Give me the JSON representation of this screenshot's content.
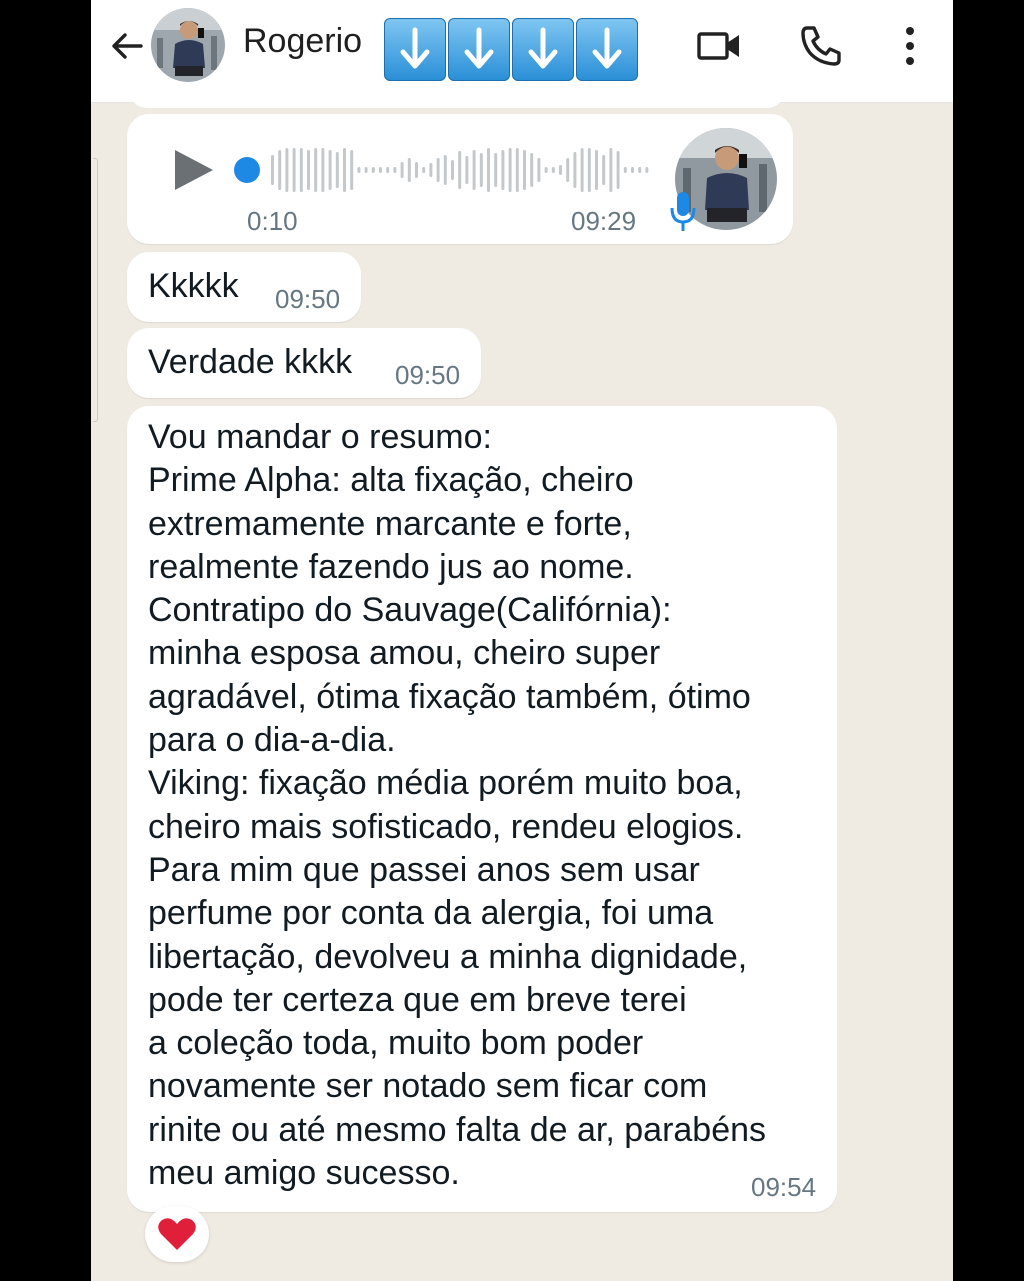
{
  "header": {
    "contact_name": "Rogerio",
    "arrow_emojis": [
      "arrow-down-emoji",
      "arrow-down-emoji",
      "arrow-down-emoji",
      "arrow-down-emoji"
    ],
    "icons": [
      "back-arrow-icon",
      "video-call-icon",
      "phone-call-icon",
      "more-options-icon"
    ]
  },
  "voice_message": {
    "duration": "0:10",
    "time": "09:29",
    "progress": 0,
    "icons": [
      "play-icon",
      "microphone-icon"
    ]
  },
  "messages": [
    {
      "text": "Kkkkk",
      "time": "09:50"
    },
    {
      "text": "Verdade kkkk",
      "time": "09:50"
    },
    {
      "text": "Vou mandar o resumo:\nPrime Alpha: alta fixação, cheiro\nextremamente marcante e forte,\nrealmente fazendo jus ao nome.\nContratipo do Sauvage(Califórnia):\nminha esposa amou, cheiro super\nagradável, ótima fixação também, ótimo\npara o dia-a-dia.\nViking: fixação média porém muito boa,\ncheiro mais sofisticado, rendeu elogios.\nPara mim que passei anos sem usar\nperfume por conta da alergia, foi uma\nlibertação,  devolveu a minha dignidade,\npode ter certeza que em breve terei\na coleção toda, muito bom poder\nnovamente ser notado sem ficar com\nrinite ou até mesmo falta de ar, parabéns\nmeu amigo sucesso.",
      "time": "09:54"
    }
  ],
  "reaction": {
    "icon": "red-heart-icon"
  },
  "colors": {
    "chat_background": "#efeae2",
    "bubble": "#ffffff",
    "accent_blue": "#1e88e5",
    "time_text": "#667781",
    "heart": "#e0203a"
  }
}
